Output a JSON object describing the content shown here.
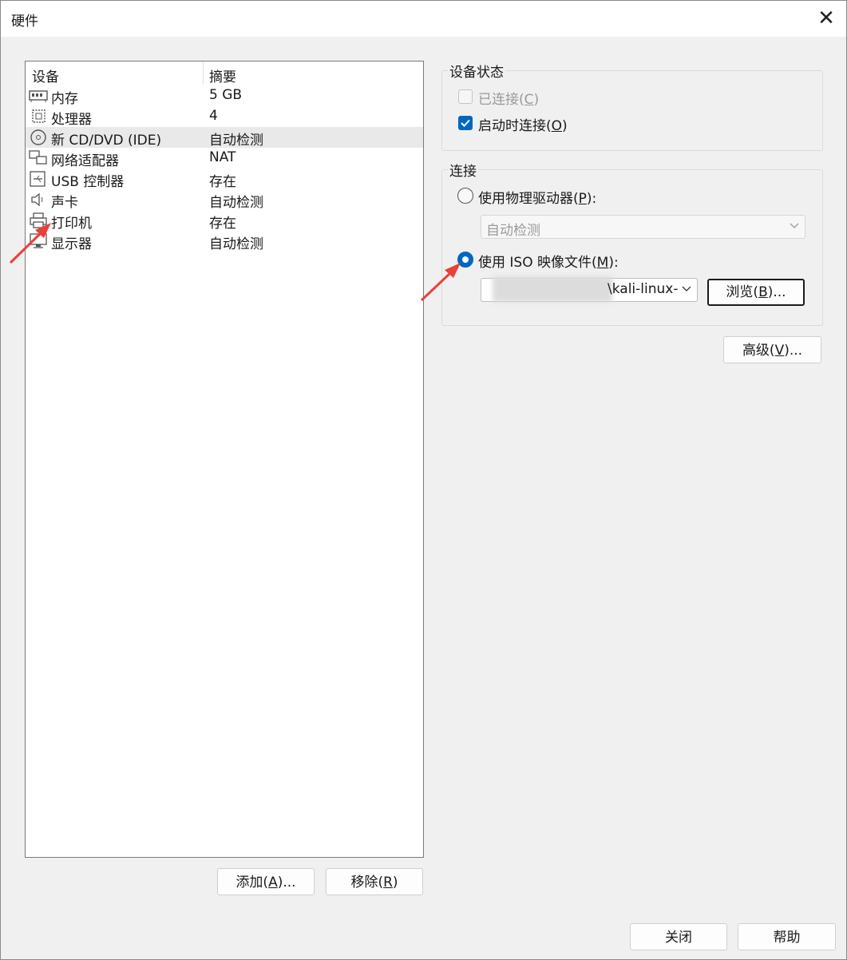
{
  "window": {
    "title": "硬件",
    "close_icon": "close-icon"
  },
  "device_list": {
    "headers": {
      "device": "设备",
      "summary": "摘要"
    },
    "rows": [
      {
        "name": "内存",
        "summary": "5 GB",
        "icon": "memory-icon",
        "selected": false
      },
      {
        "name": "处理器",
        "summary": "4",
        "icon": "processor-icon",
        "selected": false
      },
      {
        "name": "新 CD/DVD (IDE)",
        "summary": "自动检测",
        "icon": "cd-dvd-icon",
        "selected": true
      },
      {
        "name": "网络适配器",
        "summary": "NAT",
        "icon": "network-adapter-icon",
        "selected": false
      },
      {
        "name": "USB 控制器",
        "summary": "存在",
        "icon": "usb-icon",
        "selected": false
      },
      {
        "name": "声卡",
        "summary": "自动检测",
        "icon": "speaker-icon",
        "selected": false
      },
      {
        "name": "打印机",
        "summary": "存在",
        "icon": "printer-icon",
        "selected": false
      },
      {
        "name": "显示器",
        "summary": "自动检测",
        "icon": "monitor-icon",
        "selected": false
      }
    ],
    "add_button": {
      "text": "添加(",
      "key": "A",
      "suffix": ")..."
    },
    "remove_button": {
      "text": "移除(",
      "key": "R",
      "suffix": ")"
    }
  },
  "device_status": {
    "title": "设备状态",
    "connected": {
      "text": "已连接(",
      "key": "C",
      "suffix": ")",
      "checked": false,
      "disabled": true
    },
    "connect_at_power_on": {
      "text": "启动时连接(",
      "key": "O",
      "suffix": ")",
      "checked": true,
      "disabled": false
    }
  },
  "connection": {
    "title": "连接",
    "physical_drive": {
      "text": "使用物理驱动器(",
      "key": "P",
      "suffix": "):",
      "selected": false,
      "value": "自动检测"
    },
    "iso_image": {
      "text": "使用 ISO 映像文件(",
      "key": "M",
      "suffix": "):",
      "selected": true,
      "path_visible": "\\kali-linux-"
    },
    "browse_button": {
      "text": "浏览(",
      "key": "B",
      "suffix": ")..."
    }
  },
  "advanced_button": {
    "text": "高级(",
    "key": "V",
    "suffix": ")..."
  },
  "footer": {
    "close": "关闭",
    "help": "帮助"
  },
  "colors": {
    "accent": "#0067c0",
    "annotation_arrow": "#e8413a",
    "selected_row": "#e9e9e9"
  }
}
